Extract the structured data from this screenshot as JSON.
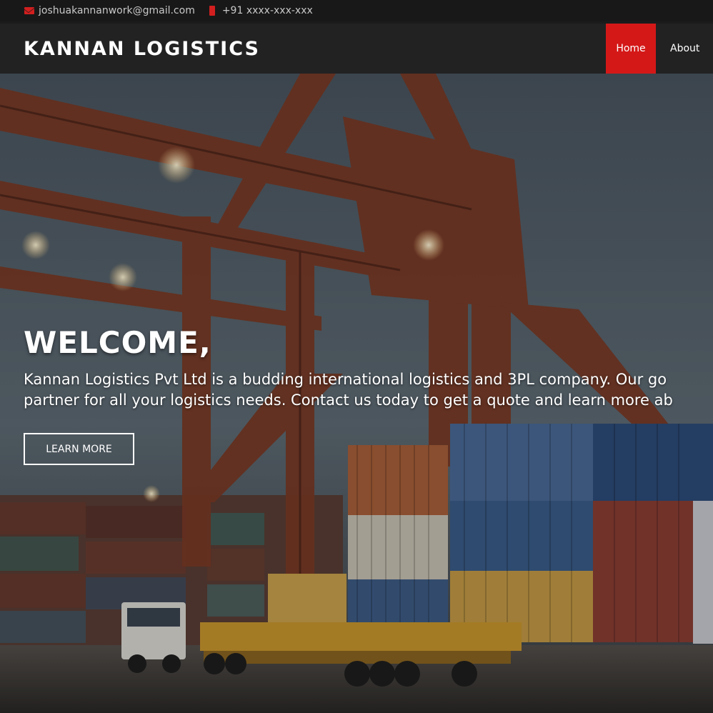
{
  "topbar": {
    "email": "joshuakannanwork@gmail.com",
    "phone": "+91 xxxx-xxx-xxx"
  },
  "navbar": {
    "brand": "KANNAN LOGISTICS",
    "links": [
      {
        "label": "Home",
        "active": true
      },
      {
        "label": "About",
        "active": false
      }
    ]
  },
  "hero": {
    "heading": "WELCOME,",
    "description_lines": [
      "Kannan Logistics Pvt Ltd is a budding international logistics and 3PL company. Our go",
      "partner for all your logistics needs. Contact us today to get a quote and learn more ab"
    ],
    "button_label": "LEARN MORE"
  },
  "colors": {
    "accent": "#d41818",
    "topbar_bg": "#181818",
    "navbar_bg": "#222222"
  },
  "icons": [
    "envelope-icon",
    "phone-icon"
  ]
}
